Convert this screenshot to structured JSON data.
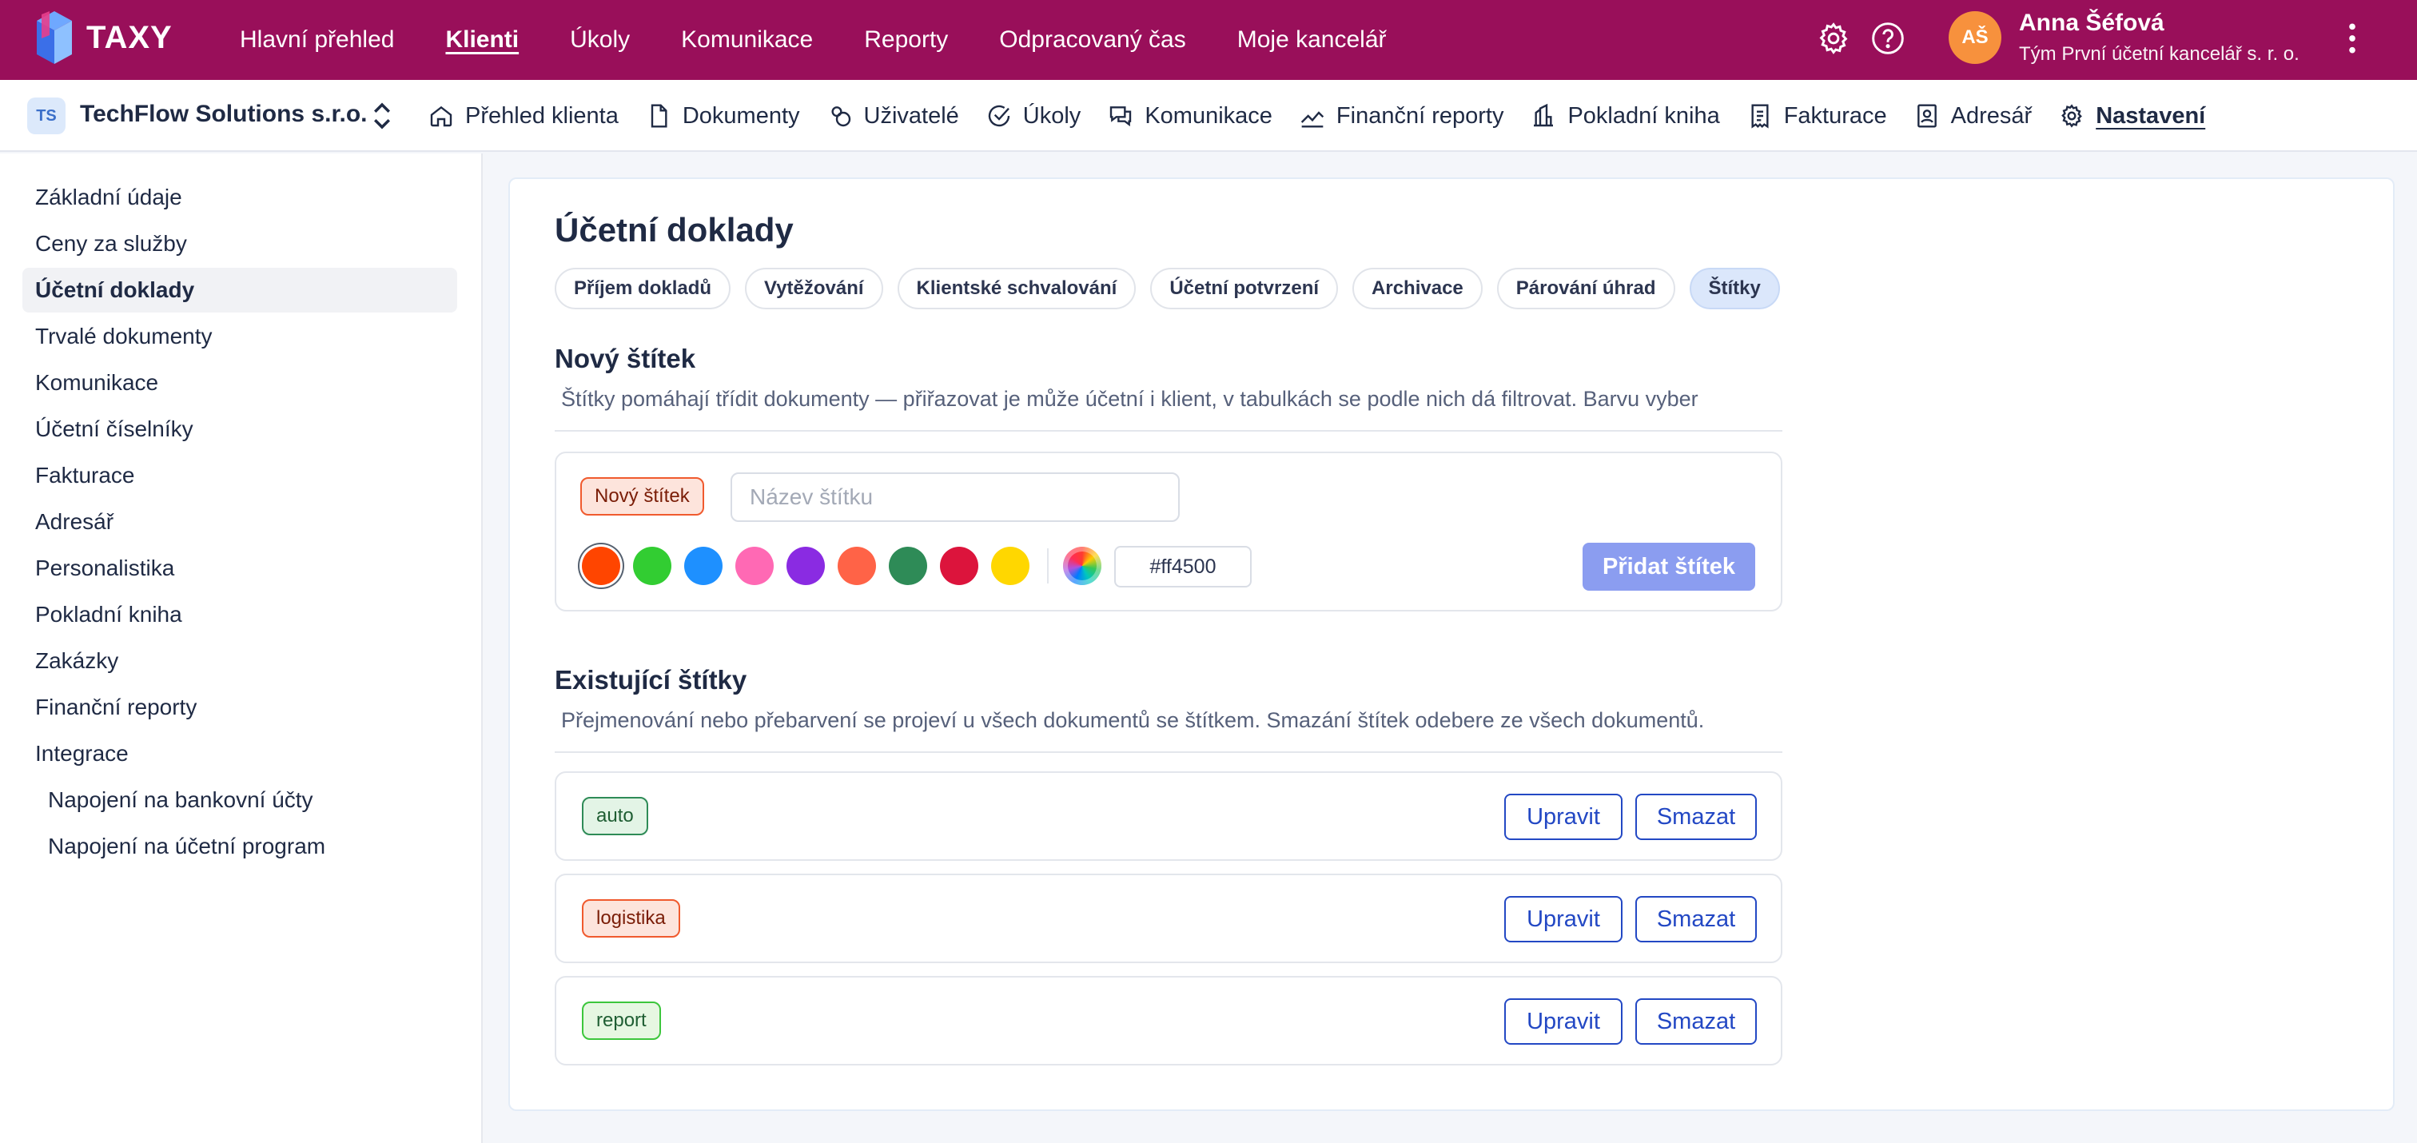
{
  "app": {
    "name": "TAXY"
  },
  "topnav": [
    {
      "label": "Hlavní přehled",
      "active": false
    },
    {
      "label": "Klienti",
      "active": true
    },
    {
      "label": "Úkoly",
      "active": false
    },
    {
      "label": "Komunikace",
      "active": false
    },
    {
      "label": "Reporty",
      "active": false
    },
    {
      "label": "Odpracovaný čas",
      "active": false
    },
    {
      "label": "Moje kancelář",
      "active": false
    }
  ],
  "user": {
    "initials": "AŠ",
    "name": "Anna Šéfová",
    "team": "Tým První účetní kancelář s. r. o."
  },
  "client": {
    "initials": "TS",
    "name": "TechFlow Solutions s.r.o."
  },
  "subnav": [
    {
      "label": "Přehled klienta",
      "icon": "home-icon"
    },
    {
      "label": "Dokumenty",
      "icon": "document-icon"
    },
    {
      "label": "Uživatelé",
      "icon": "users-icon"
    },
    {
      "label": "Úkoly",
      "icon": "check-circle-icon"
    },
    {
      "label": "Komunikace",
      "icon": "chat-icon"
    },
    {
      "label": "Finanční reporty",
      "icon": "trend-icon"
    },
    {
      "label": "Pokladní kniha",
      "icon": "cashbook-icon"
    },
    {
      "label": "Fakturace",
      "icon": "invoice-icon"
    },
    {
      "label": "Adresář",
      "icon": "contact-book-icon"
    },
    {
      "label": "Nastavení",
      "icon": "gear-icon",
      "active": true
    }
  ],
  "sidebar": [
    {
      "label": "Základní údaje"
    },
    {
      "label": "Ceny za služby"
    },
    {
      "label": "Účetní doklady",
      "active": true
    },
    {
      "label": "Trvalé dokumenty"
    },
    {
      "label": "Komunikace"
    },
    {
      "label": "Účetní číselníky"
    },
    {
      "label": "Fakturace"
    },
    {
      "label": "Adresář"
    },
    {
      "label": "Personalistika"
    },
    {
      "label": "Pokladní kniha"
    },
    {
      "label": "Zakázky"
    },
    {
      "label": "Finanční reporty"
    },
    {
      "label": "Integrace"
    },
    {
      "label": "Napojení na bankovní účty",
      "sub": true
    },
    {
      "label": "Napojení na účetní program",
      "sub": true
    }
  ],
  "page": {
    "title": "Účetní doklady",
    "tabs": [
      {
        "label": "Příjem dokladů"
      },
      {
        "label": "Vytěžování"
      },
      {
        "label": "Klientské schvalování"
      },
      {
        "label": "Účetní potvrzení"
      },
      {
        "label": "Archivace"
      },
      {
        "label": "Párování úhrad"
      },
      {
        "label": "Štítky",
        "active": true
      }
    ]
  },
  "new_tag": {
    "title": "Nový štítek",
    "description": "Štítky pomáhají třídit dokumenty — přiřazovat je může účetní i klient, v tabulkách se podle nich dá filtrovat. Barvu vyber",
    "preview_label": "Nový štítek",
    "name_placeholder": "Název štítku",
    "name_value": "",
    "colors": [
      "#ff4500",
      "#32cd32",
      "#1e90ff",
      "#ff69b4",
      "#8a2be2",
      "#ff6347",
      "#2e8b57",
      "#dc143c",
      "#ffd700"
    ],
    "selected_color": "#ff4500",
    "hex_value": "#ff4500",
    "add_button": "Přidat štítek"
  },
  "existing": {
    "title": "Existující štítky",
    "description": "Přejmenování nebo přebarvení se projeví u všech dokumentů se štítkem. Smazání štítek odebere ze všech dokumentů.",
    "edit_label": "Upravit",
    "delete_label": "Smazat",
    "tags": [
      {
        "label": "auto",
        "color": "#2e8b57"
      },
      {
        "label": "logistika",
        "color": "#ff4500"
      },
      {
        "label": "report",
        "color": "#32cd32"
      }
    ]
  }
}
